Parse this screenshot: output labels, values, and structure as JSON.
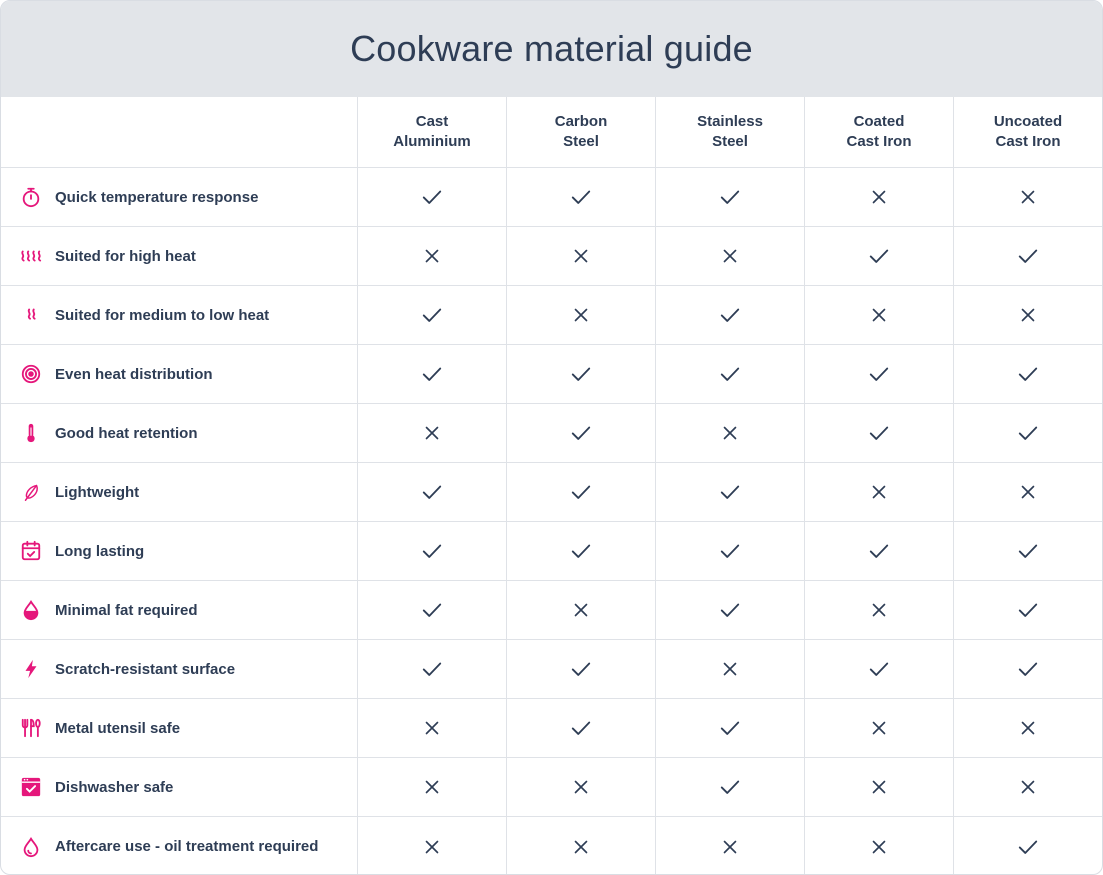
{
  "title": "Cookware material guide",
  "accent_color": "#e5177b",
  "text_color": "#2e3d55",
  "columns": [
    "Cast\nAluminium",
    "Carbon\nSteel",
    "Stainless\nSteel",
    "Coated\nCast Iron",
    "Uncoated\nCast Iron"
  ],
  "rows": [
    {
      "label": "Quick temperature response",
      "icon": "stopwatch-icon",
      "values": [
        true,
        true,
        true,
        false,
        false
      ]
    },
    {
      "label": "Suited for high heat",
      "icon": "high-heat-icon",
      "values": [
        false,
        false,
        false,
        true,
        true
      ]
    },
    {
      "label": "Suited for medium to low heat",
      "icon": "medium-heat-icon",
      "values": [
        true,
        false,
        true,
        false,
        false
      ]
    },
    {
      "label": "Even heat distribution",
      "icon": "target-icon",
      "values": [
        true,
        true,
        true,
        true,
        true
      ]
    },
    {
      "label": "Good heat retention",
      "icon": "thermometer-icon",
      "values": [
        false,
        true,
        false,
        true,
        true
      ]
    },
    {
      "label": "Lightweight",
      "icon": "feather-icon",
      "values": [
        true,
        true,
        true,
        false,
        false
      ]
    },
    {
      "label": "Long lasting",
      "icon": "calendar-check-icon",
      "values": [
        true,
        true,
        true,
        true,
        true
      ]
    },
    {
      "label": "Minimal fat required",
      "icon": "oil-drop-icon",
      "values": [
        true,
        false,
        true,
        false,
        true
      ]
    },
    {
      "label": "Scratch-resistant surface",
      "icon": "lightning-icon",
      "values": [
        true,
        true,
        false,
        true,
        true
      ]
    },
    {
      "label": "Metal utensil safe",
      "icon": "utensils-icon",
      "values": [
        false,
        true,
        true,
        false,
        false
      ]
    },
    {
      "label": "Dishwasher safe",
      "icon": "dishwasher-icon",
      "values": [
        false,
        false,
        true,
        false,
        false
      ]
    },
    {
      "label": "Aftercare use - oil treatment required",
      "icon": "drop-outline-icon",
      "values": [
        false,
        false,
        false,
        false,
        true
      ]
    }
  ]
}
